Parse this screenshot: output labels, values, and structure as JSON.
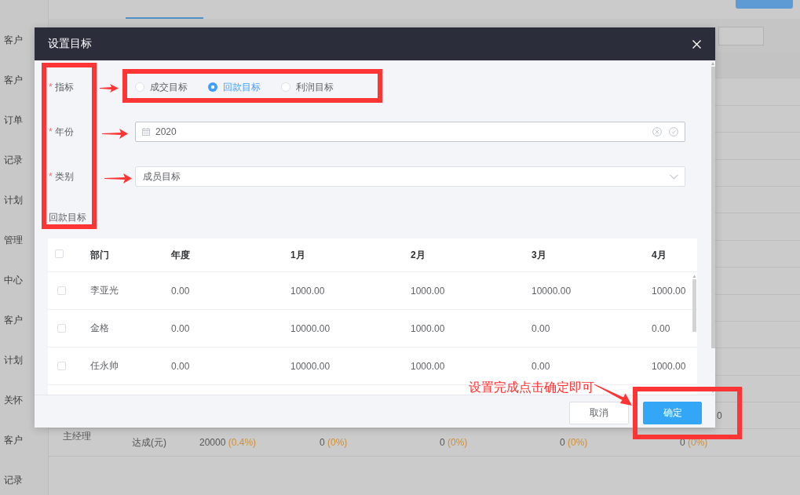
{
  "sidebar": {
    "items": [
      "客户",
      "客户",
      "订单",
      "记录",
      "计划",
      "管理",
      "中心",
      "客户",
      "计划",
      "关怀",
      "客户",
      "记录"
    ]
  },
  "report_table": {
    "partial_cell": "0",
    "summary_row": {
      "group": "主经理",
      "metric": "达成(元)",
      "cells": [
        {
          "value": "20000",
          "percent": "(0.4%)"
        },
        {
          "value": "0",
          "percent": "(0%)"
        },
        {
          "value": "0",
          "percent": "(0%)"
        },
        {
          "value": "0",
          "percent": "(0%)"
        },
        {
          "value": "0",
          "percent": "(0%)"
        }
      ]
    }
  },
  "dialog": {
    "title": "设置目标",
    "fields": [
      {
        "kind": "radio",
        "marker": "*",
        "label": "指标",
        "options": [
          {
            "label": "成交目标",
            "selected": false
          },
          {
            "label": "回款目标",
            "selected": true
          },
          {
            "label": "利润目标",
            "selected": false
          }
        ]
      },
      {
        "kind": "date",
        "marker": "*",
        "label": "年份",
        "value": "2020"
      },
      {
        "kind": "select",
        "marker": "*",
        "label": "类别",
        "value": "成员目标"
      },
      {
        "kind": "section",
        "label": "回款目标"
      }
    ],
    "table": {
      "header_checked": false,
      "columns": [
        "部门",
        "年度",
        "1月",
        "2月",
        "3月",
        "4月"
      ],
      "rows": [
        {
          "checked": false,
          "cells": [
            "李亚光",
            "0.00",
            "1000.00",
            "1000.00",
            "10000.00",
            "1000.00"
          ]
        },
        {
          "checked": false,
          "cells": [
            "金格",
            "0.00",
            "10000.00",
            "1000.00",
            "0.00",
            "0.00"
          ]
        },
        {
          "checked": false,
          "cells": [
            "任永帅",
            "0.00",
            "10000.00",
            "1000.00",
            "0.00",
            "1000.00"
          ]
        }
      ]
    },
    "buttons": [
      {
        "label": "取消",
        "kind": "secondary"
      },
      {
        "label": "确定",
        "kind": "primary"
      }
    ]
  },
  "annotation": {
    "text": "设置完成点击确定即可"
  }
}
